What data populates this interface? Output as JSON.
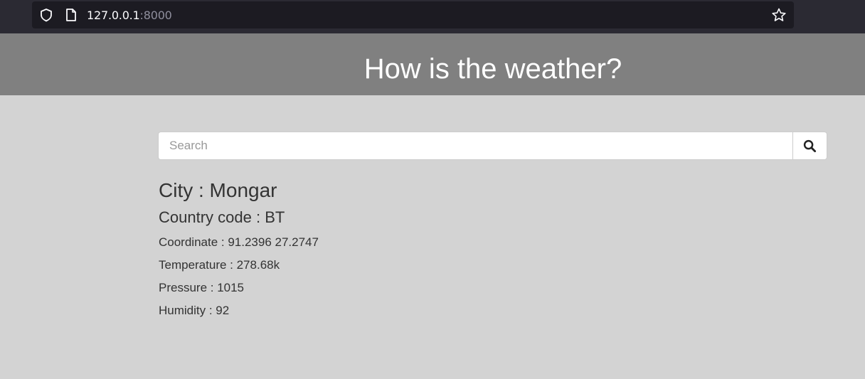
{
  "browser": {
    "url_host": "127.0.0.1",
    "url_port": ":8000"
  },
  "header": {
    "title": "How is the weather?"
  },
  "search": {
    "placeholder": "Search",
    "value": ""
  },
  "weather": {
    "city": "City : Mongar",
    "country": "Country code : BT",
    "coordinate": "Coordinate : 91.2396 27.2747",
    "temperature": "Temperature : 278.68k",
    "pressure": "Pressure : 1015",
    "humidity": "Humidity : 92"
  },
  "icons": {
    "shield": "shield-icon",
    "page": "page-icon",
    "star": "star-icon",
    "search": "search-icon"
  }
}
